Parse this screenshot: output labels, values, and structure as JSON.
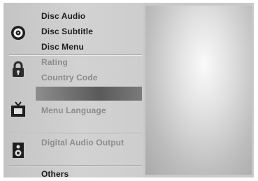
{
  "menu": {
    "disc": {
      "icon": "disc-icon",
      "items": [
        "Disc Audio",
        "Disc Subtitle",
        "Disc Menu"
      ]
    },
    "lock": {
      "icon": "padlock-icon",
      "items": [
        "Rating",
        "Country Code"
      ]
    },
    "tv": {
      "icon": "tv-icon",
      "items": [
        "Menu Language"
      ]
    },
    "audio": {
      "icon": "speaker-icon",
      "items": [
        "Digital Audio Output"
      ]
    },
    "others": {
      "items": [
        "Others"
      ]
    }
  },
  "colors": {
    "menu_bg": "#cbcbcb",
    "active_text": "#1e1e1e",
    "dim_text": "#8c8c8c",
    "highlight_bar": "#5a5a5a"
  }
}
